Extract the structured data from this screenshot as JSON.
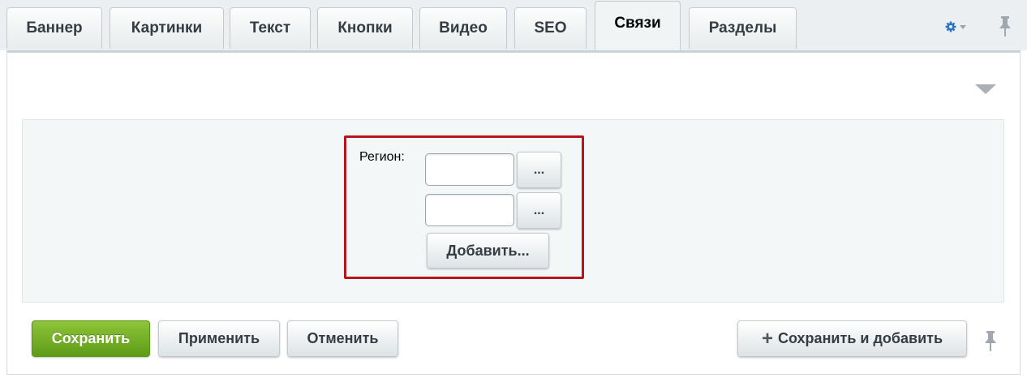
{
  "tabs": [
    {
      "label": "Баннер"
    },
    {
      "label": "Картинки"
    },
    {
      "label": "Текст"
    },
    {
      "label": "Кнопки"
    },
    {
      "label": "Видео"
    },
    {
      "label": "SEO"
    },
    {
      "label": "Связи",
      "active": true
    },
    {
      "label": "Разделы"
    }
  ],
  "form": {
    "region_label": "Регион:",
    "region_inputs": [
      "",
      ""
    ],
    "browse_label": "...",
    "add_label": "Добавить..."
  },
  "footer": {
    "save_label": "Сохранить",
    "apply_label": "Применить",
    "cancel_label": "Отменить",
    "save_add_label": "Сохранить и добавить"
  },
  "icons": {
    "settings": "gear-icon",
    "pin": "pin-icon",
    "collapse": "triangle-down-icon",
    "plus": "plus-icon"
  },
  "colors": {
    "accent_blue": "#2a73c9",
    "save_green": "#6aaa1e",
    "highlight_red": "#b8141b"
  }
}
